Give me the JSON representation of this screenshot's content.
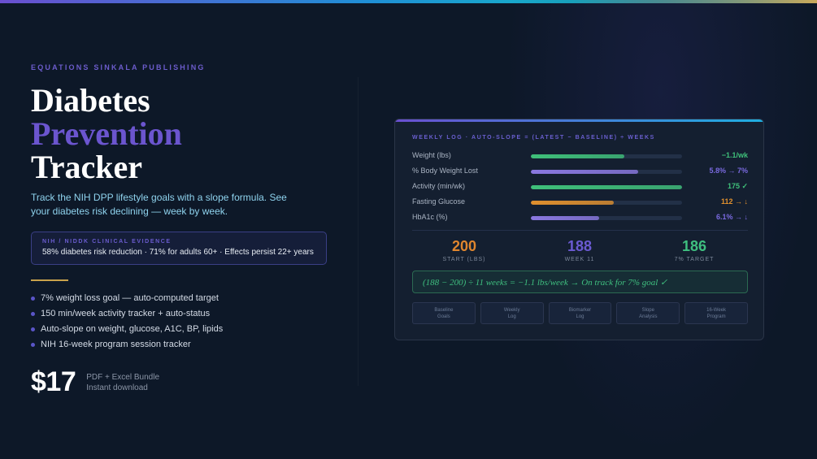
{
  "publisher": "EQUATIONS SINKALA PUBLISHING",
  "title": {
    "line1": "Diabetes",
    "line2": "Prevention",
    "line3": "Tracker"
  },
  "subtitle": "Track the NIH DPP lifestyle goals with a slope formula. See your diabetes risk declining — week by week.",
  "evidence": {
    "label": "NIH / NIDDK CLINICAL EVIDENCE",
    "text": "58% diabetes risk reduction · 71% for adults 60+ · Effects persist 22+ years"
  },
  "features": [
    "7% weight loss goal — auto-computed target",
    "150 min/week activity tracker + auto-status",
    "Auto-slope on weight, glucose, A1C, BP, lipids",
    "NIH 16-week program session tracker"
  ],
  "price": {
    "amount": "$17",
    "line1": "PDF + Excel Bundle",
    "line2": "Instant download"
  },
  "card": {
    "header": "WEEKLY LOG · AUTO-SLOPE = (LATEST − BASELINE) ÷ WEEKS",
    "metrics": [
      {
        "label": "Weight (lbs)",
        "value": "−1.1/wk",
        "fill": 0.62,
        "bar_color": "#3fc07a",
        "value_color": "#3fc07a"
      },
      {
        "label": "% Body Weight Lost",
        "value": "5.8% → 7%",
        "fill": 0.71,
        "bar_color": "#8a78e0",
        "value_color": "#7a6ae0"
      },
      {
        "label": "Activity (min/wk)",
        "value": "175 ✓",
        "fill": 1.0,
        "bar_color": "#3fc07a",
        "value_color": "#3fc07a"
      },
      {
        "label": "Fasting Glucose",
        "value": "112 → ↓",
        "fill": 0.55,
        "bar_color": "#e0902e",
        "value_color": "#e0902e"
      },
      {
        "label": "HbA1c (%)",
        "value": "6.1% → ↓",
        "fill": 0.45,
        "bar_color": "#8a78e0",
        "value_color": "#7a6ae0"
      }
    ],
    "stats": [
      {
        "number": "200",
        "label": "START (LBS)",
        "color": "#e0862e"
      },
      {
        "number": "188",
        "label": "WEEK 11",
        "color": "#6b5ad2"
      },
      {
        "number": "186",
        "label": "7% TARGET",
        "color": "#3fbf7f"
      }
    ],
    "formula": "(188 − 200) ÷ 11 weeks = −1.1 lbs/week → On track for 7% goal ✓",
    "tabs": [
      {
        "line1": "Baseline",
        "line2": "Goals"
      },
      {
        "line1": "Weekly",
        "line2": "Log"
      },
      {
        "line1": "Biomarker",
        "line2": "Log"
      },
      {
        "line1": "Slope",
        "line2": "Analysis"
      },
      {
        "line1": "16-Week",
        "line2": "Program"
      }
    ]
  }
}
